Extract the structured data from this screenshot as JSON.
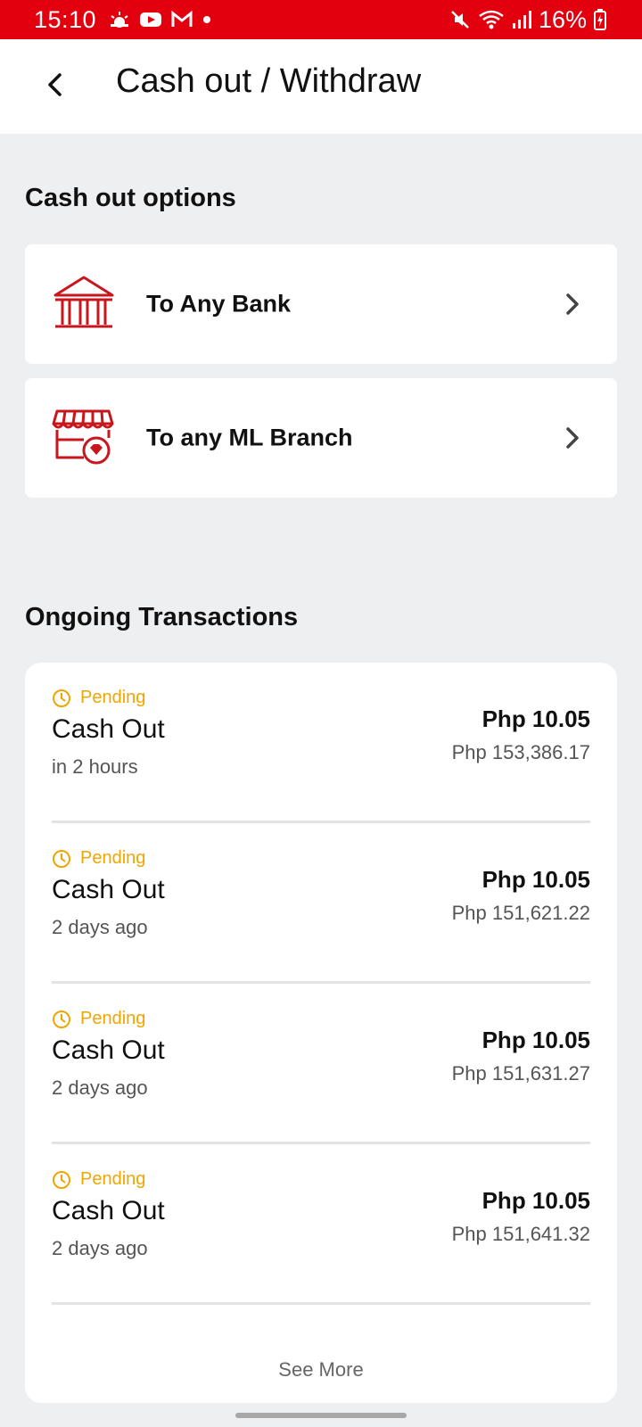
{
  "status_bar": {
    "time": "15:10",
    "battery": "16%",
    "left_icons": [
      "weather-icon",
      "youtube-icon",
      "gmail-icon",
      "dot-icon"
    ],
    "right_icons": [
      "mute-icon",
      "wifi-icon",
      "signal-icon",
      "battery-charging-icon"
    ]
  },
  "header": {
    "title": "Cash out / Withdraw"
  },
  "options": {
    "title": "Cash out options",
    "items": [
      {
        "label": "To Any Bank",
        "icon": "bank-icon"
      },
      {
        "label": "To any ML Branch",
        "icon": "store-branch-icon"
      }
    ]
  },
  "transactions": {
    "title": "Ongoing Transactions",
    "items": [
      {
        "status": "Pending",
        "title": "Cash Out",
        "time": "in 2 hours",
        "amount": "Php 10.05",
        "balance": "Php 153,386.17"
      },
      {
        "status": "Pending",
        "title": "Cash Out",
        "time": "2 days ago",
        "amount": "Php 10.05",
        "balance": "Php 151,621.22"
      },
      {
        "status": "Pending",
        "title": "Cash Out",
        "time": "2 days ago",
        "amount": "Php 10.05",
        "balance": "Php 151,631.27"
      },
      {
        "status": "Pending",
        "title": "Cash Out",
        "time": "2 days ago",
        "amount": "Php 10.05",
        "balance": "Php 151,641.32"
      }
    ],
    "see_more": "See More"
  },
  "colors": {
    "brand_red": "#e2000f",
    "pending": "#f0a500",
    "icon_red": "#c8161d"
  }
}
